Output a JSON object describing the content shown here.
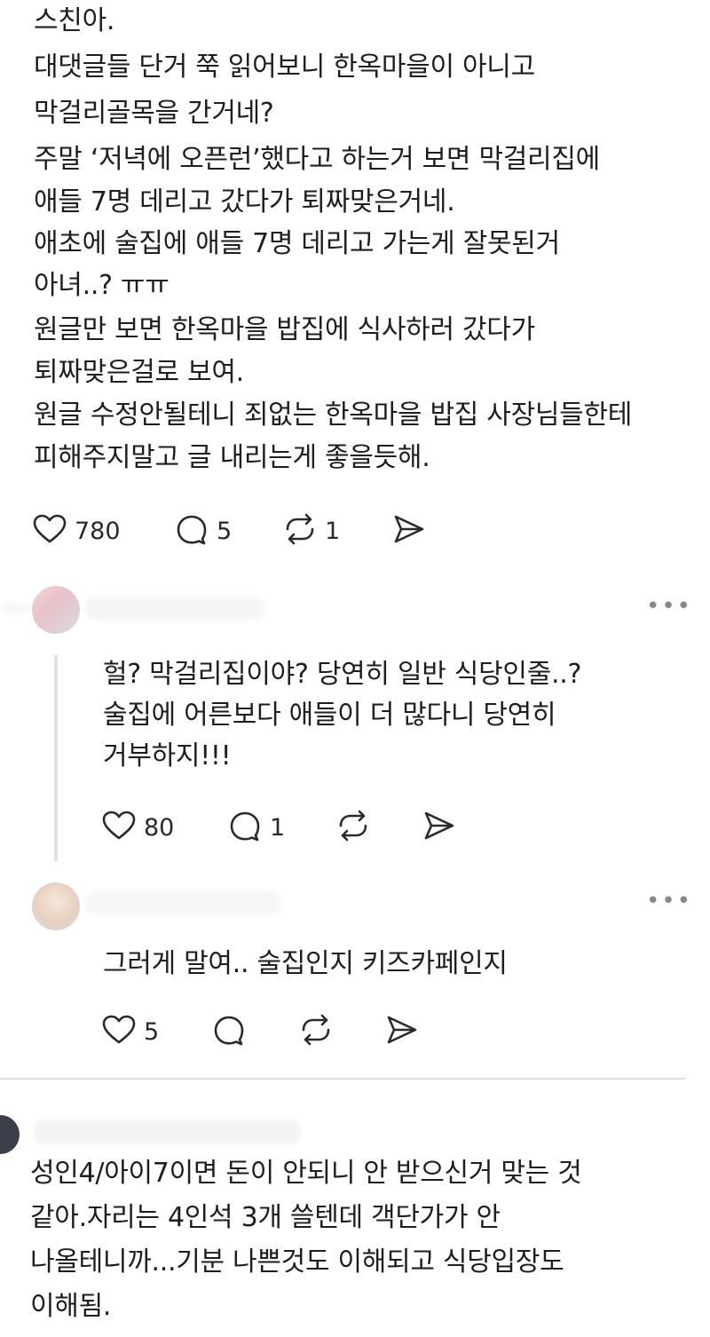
{
  "post": {
    "lines": [
      "스친아.",
      "대댓글들 단거 쭉 읽어보니 한옥마을이 아니고",
      "막걸리골목을 간거네?",
      "주말 ‘저녁에 오픈런’했다고 하는거 보면 막걸리집에",
      "애들 7명 데리고 갔다가 퇴짜맞은거네.",
      "애초에 술집에 애들 7명 데리고 가는게 잘못된거",
      "아녀..? ㅠㅠ",
      "원글만 보면 한옥마을 밥집에 식사하러 갔다가",
      "퇴짜맞은걸로 보여.",
      "원글 수정안될테니 죄없는 한옥마을 밥집 사장님들한테",
      "피해주지말고 글 내리는게 좋을듯해."
    ],
    "likes": "780",
    "comments": "5",
    "reposts": "1"
  },
  "reply1": {
    "more": "•••",
    "lines": [
      "헐? 막걸리집이야? 당연히 일반 식당인줄..?",
      "술집에 어른보다 애들이 더 많다니 당연히",
      "거부하지!!!"
    ],
    "likes": "80",
    "comments": "1"
  },
  "reply2": {
    "more": "•••",
    "lines": [
      "그러게 말여.. 술집인지 키즈카페인지"
    ],
    "likes": "5"
  },
  "comment3": {
    "lines": [
      "성인4/아이7이면 돈이 안되니 안 받으신거 맞는 것",
      "같아.자리는 4인석 3개 쓸텐데 객단가가 안",
      "나올테니까...기분 나쁜것도 이해되고 식당입장도",
      "이해됨."
    ]
  },
  "colors": {
    "text": "#1e1e1e",
    "icon": "#2a2a2a",
    "divider": "#dcdcdc"
  }
}
